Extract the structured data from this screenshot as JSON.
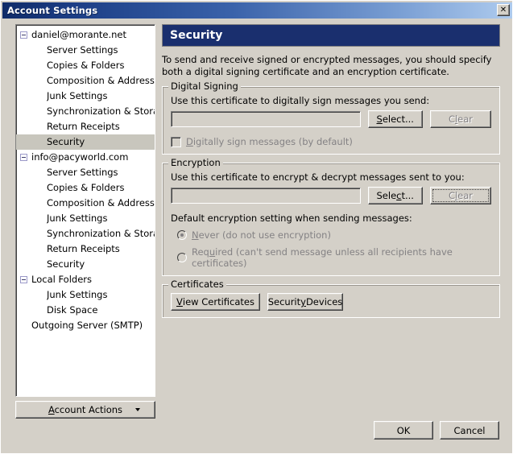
{
  "window": {
    "title": "Account Settings",
    "close_label": "✕"
  },
  "sidebar": {
    "items": [
      {
        "label": "daniel@morante.net",
        "level": "root",
        "expanded": true,
        "selected": false
      },
      {
        "label": "Server Settings",
        "level": "child",
        "expanded": false,
        "selected": false
      },
      {
        "label": "Copies & Folders",
        "level": "child",
        "expanded": false,
        "selected": false
      },
      {
        "label": "Composition & Addressing",
        "level": "child",
        "expanded": false,
        "selected": false
      },
      {
        "label": "Junk Settings",
        "level": "child",
        "expanded": false,
        "selected": false
      },
      {
        "label": "Synchronization & Storage",
        "level": "child",
        "expanded": false,
        "selected": false
      },
      {
        "label": "Return Receipts",
        "level": "child",
        "expanded": false,
        "selected": false
      },
      {
        "label": "Security",
        "level": "child",
        "expanded": false,
        "selected": true
      },
      {
        "label": "info@pacyworld.com",
        "level": "root",
        "expanded": true,
        "selected": false
      },
      {
        "label": "Server Settings",
        "level": "child",
        "expanded": false,
        "selected": false
      },
      {
        "label": "Copies & Folders",
        "level": "child",
        "expanded": false,
        "selected": false
      },
      {
        "label": "Composition & Addressing",
        "level": "child",
        "expanded": false,
        "selected": false
      },
      {
        "label": "Junk Settings",
        "level": "child",
        "expanded": false,
        "selected": false
      },
      {
        "label": "Synchronization & Storage",
        "level": "child",
        "expanded": false,
        "selected": false
      },
      {
        "label": "Return Receipts",
        "level": "child",
        "expanded": false,
        "selected": false
      },
      {
        "label": "Security",
        "level": "child",
        "expanded": false,
        "selected": false
      },
      {
        "label": "Local Folders",
        "level": "root",
        "expanded": true,
        "selected": false
      },
      {
        "label": "Junk Settings",
        "level": "child",
        "expanded": false,
        "selected": false
      },
      {
        "label": "Disk Space",
        "level": "child",
        "expanded": false,
        "selected": false
      },
      {
        "label": "Outgoing Server (SMTP)",
        "level": "flat",
        "expanded": false,
        "selected": false
      }
    ],
    "account_actions_label": "Account Actions",
    "account_actions_accel": "A",
    "account_actions_arrow": "▼"
  },
  "main": {
    "header_title": "Security",
    "description": "To send and receive signed or encrypted messages, you should specify both a digital signing certificate and an encryption certificate.",
    "digital_signing": {
      "group_title": "Digital Signing",
      "instruction": "Use this certificate to digitally sign messages you send:",
      "cert_value": "",
      "cert_placeholder": "",
      "select_label_pre": "",
      "select_accel": "S",
      "select_label_post": "elect...",
      "clear_label_pre": "C",
      "clear_accel": "l",
      "clear_label_post": "ear",
      "clear_disabled": true,
      "checkbox_label_pre": "",
      "checkbox_accel": "D",
      "checkbox_label_post": "igitally sign messages (by default)",
      "checkbox_checked": false,
      "checkbox_disabled": true
    },
    "encryption": {
      "group_title": "Encryption",
      "instruction": "Use this certificate to encrypt & decrypt messages sent to you:",
      "cert_value": "",
      "cert_placeholder": "",
      "select_accel": "c",
      "select_label_pre": "Sele",
      "select_label_post": "t...",
      "clear_label_pre": "C",
      "clear_accel": "l",
      "clear_label_post": "ear",
      "clear_disabled": true,
      "clear_focused": true,
      "default_label": "Default encryption setting when sending messages:",
      "options": [
        {
          "accel": "N",
          "pre": "",
          "post": "ever (do not use encryption)",
          "selected": true,
          "disabled": true
        },
        {
          "accel": "u",
          "pre": "Req",
          "post": "ired (can't send message unless all recipients have certificates)",
          "selected": false,
          "disabled": true
        }
      ]
    },
    "certificates": {
      "group_title": "Certificates",
      "view_label_pre": "",
      "view_accel": "V",
      "view_label_post": "iew Certificates",
      "devices_label_pre": "Securit",
      "devices_accel": "y",
      "devices_label_post": " Devices"
    }
  },
  "footer": {
    "ok_label": "OK",
    "cancel_label": "Cancel"
  },
  "colors": {
    "dialog_bg": "#d4d0c8",
    "header_blue": "#1a2f6e",
    "titlebar_dark": "#0f2b68",
    "titlebar_light": "#aecbee",
    "selection_gray": "#c8c6bd",
    "disabled_text": "#848284"
  }
}
